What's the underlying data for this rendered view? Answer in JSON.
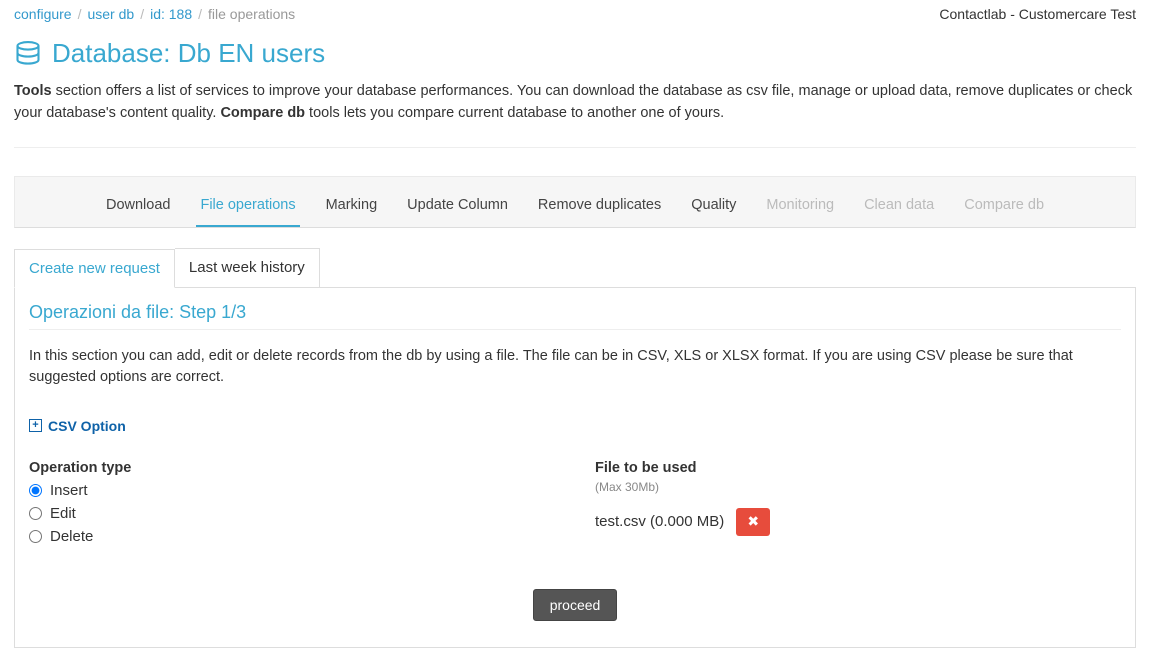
{
  "brand": "Contactlab - Customercare Test",
  "breadcrumb": {
    "configure": "configure",
    "userdb": "user db",
    "id": "id: 188",
    "current": "file operations"
  },
  "page_title": "Database: Db EN users",
  "intro": {
    "tools_label": "Tools",
    "text1": " section offers a list of services to improve your database performances. You can download the database as csv file, manage or upload data, remove duplicates or check your database's content quality. ",
    "compare_label": "Compare db",
    "text2": " tools lets you compare current database to another one of yours."
  },
  "tabs": {
    "download": "Download",
    "file_ops": "File operations",
    "marking": "Marking",
    "update_col": "Update Column",
    "remove_dup": "Remove duplicates",
    "quality": "Quality",
    "monitoring": "Monitoring",
    "clean": "Clean data",
    "compare": "Compare db"
  },
  "subtabs": {
    "create": "Create new request",
    "history": "Last week history"
  },
  "step": {
    "title": "Operazioni da file: Step 1/3",
    "desc": "In this section you can add, edit or delete records from the db by using a file. The file can be in CSV, XLS or XLSX format. If you are using CSV please be sure that suggested options are correct.",
    "csv_option": "CSV Option"
  },
  "op": {
    "label": "Operation type",
    "insert": "Insert",
    "edit": "Edit",
    "delete": "Delete"
  },
  "file": {
    "label": "File to be used",
    "sub": "(Max 30Mb)",
    "name": "test.csv (0.000 MB)"
  },
  "proceed": "proceed"
}
